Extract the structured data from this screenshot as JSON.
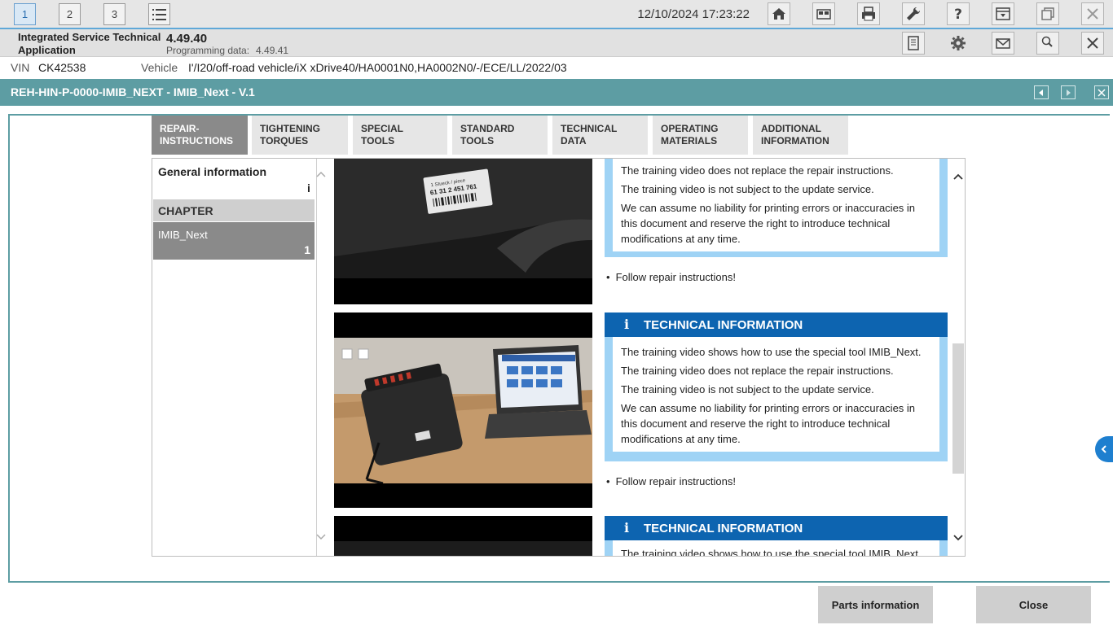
{
  "topbar": {
    "workspaces": [
      "1",
      "2",
      "3"
    ],
    "datetime": "12/10/2024 17:23:22"
  },
  "infobar": {
    "app_name": "Integrated Service Technical Application",
    "version": "4.49.40",
    "prog_label": "Programming data:",
    "prog_value": "4.49.41"
  },
  "vinbar": {
    "vin_label": "VIN",
    "vin": "CK42538",
    "vehicle_label": "Vehicle",
    "vehicle": "I'/I20/off-road vehicle/iX xDrive40/HA0001N0,HA0002N0/-/ECE/LL/2022/03"
  },
  "document": {
    "title": "REH-HIN-P-0000-IMIB_NEXT - IMIB_Next - V.1"
  },
  "tabs": [
    {
      "label": "Repair-\ninstructions",
      "active": true
    },
    {
      "label": "Tightening\ntorques",
      "active": false
    },
    {
      "label": "Special tools",
      "active": false
    },
    {
      "label": "Standard\ntools",
      "active": false
    },
    {
      "label": "Technical\ndata",
      "active": false
    },
    {
      "label": "Operating\nmaterials",
      "active": false
    },
    {
      "label": "Additional\ninformation",
      "active": false
    }
  ],
  "leftpanel": {
    "general_info": "General information",
    "general_marker": "i",
    "chapter_header": "CHAPTER",
    "chapter_item": "IMIB_Next",
    "chapter_count": "1"
  },
  "photo_label": {
    "line1": "1 Stueck / piece",
    "line2": "61 31 2 451 761"
  },
  "blocks": {
    "heading": "TECHNICAL INFORMATION",
    "line_1": "The training video shows how to use the special tool IMIB_Next.",
    "line_2": "The training video does not replace the repair instructions.",
    "line_3": "The training video is not subject to the update service.",
    "line_4": "We can assume no liability for printing errors or inaccuracies in this document and reserve the right to introduce technical modifications at any time.",
    "bullet": "Follow repair instructions!",
    "partial_line": "The training video shows how to use the special tool IMIB_Next."
  },
  "buttons": {
    "parts": "Parts information",
    "close": "Close"
  },
  "icons": {
    "home": "home-icon",
    "settings": "gear-icon",
    "wrench": "wrench-icon",
    "help": "help-icon",
    "mail": "mail-icon"
  }
}
